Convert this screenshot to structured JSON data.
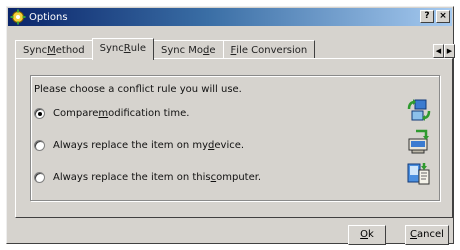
{
  "window": {
    "title": "Options",
    "help_label": "?",
    "close_label": "×"
  },
  "tabs": [
    {
      "pre": "Sync ",
      "key": "M",
      "post": "ethod"
    },
    {
      "pre": "Sync ",
      "key": "R",
      "post": "ule"
    },
    {
      "pre": "Sync Mo",
      "key": "d",
      "post": "e"
    },
    {
      "pre": "",
      "key": "F",
      "post": "ile Conversion"
    }
  ],
  "tab_scroll": {
    "left_label": "◀",
    "right_label": "▶"
  },
  "rule": {
    "prompt": "Please choose a conflict rule you will use.",
    "options": [
      {
        "pre": "Compare ",
        "key": "m",
        "post": "odification time.",
        "checked": true,
        "icon": "sync-arrows-icon"
      },
      {
        "pre": "Always replace the item on my ",
        "key": "d",
        "post": "evice.",
        "checked": false,
        "icon": "device-replace-icon"
      },
      {
        "pre": "Always replace the item on this ",
        "key": "c",
        "post": "omputer.",
        "checked": false,
        "icon": "computer-replace-icon"
      }
    ]
  },
  "buttons": {
    "ok": {
      "pre": "",
      "key": "O",
      "post": "k"
    },
    "cancel": {
      "pre": "",
      "key": "C",
      "post": "ancel"
    }
  },
  "colors": {
    "title_start": "#0a246a",
    "title_end": "#a6caf0",
    "face": "#d6d3ce"
  }
}
